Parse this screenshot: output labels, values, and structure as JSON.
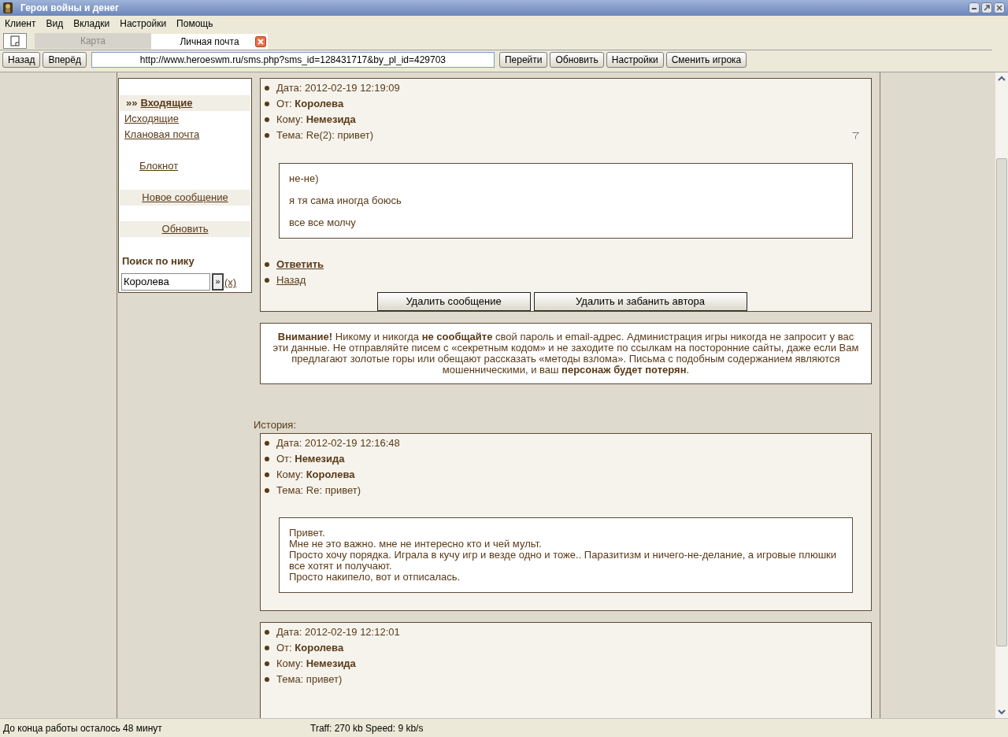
{
  "window": {
    "title": "Герои войны и денег"
  },
  "menu": [
    "Клиент",
    "Вид",
    "Вкладки",
    "Настройки",
    "Помощь"
  ],
  "tabs": [
    {
      "label": "Карта",
      "selected": false,
      "closable": false
    },
    {
      "label": "Личная почта",
      "selected": true,
      "closable": true
    }
  ],
  "nav": {
    "back": "Назад",
    "forward": "Вперёд",
    "url": "http://www.heroeswm.ru/sms.php?sms_id=128431717&by_pl_id=429703",
    "buttons": [
      "Перейти",
      "Обновить",
      "Настройки",
      "Сменить игрока"
    ]
  },
  "sidebar": {
    "items": [
      {
        "kind": "folder",
        "label": "Входящие",
        "marker": "»»",
        "selected": true
      },
      {
        "kind": "folder",
        "label": "Исходящие",
        "selected": false
      },
      {
        "kind": "folder",
        "label": "Клановая почта",
        "selected": false
      },
      {
        "kind": "tool",
        "label": "Блокнот",
        "selected": false
      },
      {
        "kind": "action",
        "label": "Новое сообщение",
        "selected": false
      },
      {
        "kind": "action",
        "label": "Обновить",
        "selected": false
      }
    ],
    "search_label": "Поиск по нику",
    "search_value": "Королева",
    "search_button": "»",
    "clear_link": "(x)"
  },
  "message": {
    "fields": [
      {
        "label": "Дата:",
        "value": "2012-02-19 12:19:09",
        "bold": false
      },
      {
        "label": "От:",
        "value": "Королева",
        "bold": true
      },
      {
        "label": "Кому:",
        "value": "Немезида",
        "bold": true
      },
      {
        "label": "Тема:",
        "value": "Re(2): привет)",
        "bold": false
      }
    ],
    "kind": "paragraphs",
    "body": [
      "не-не)",
      "я тя сама иногда боюсь",
      "все все молчу"
    ],
    "actions": [
      {
        "label": "Ответить",
        "bold": true
      },
      {
        "label": "Назад",
        "bold": false
      }
    ],
    "buttons": [
      "Удалить сообщение",
      "Удалить и забанить автора"
    ]
  },
  "warning": "**Внимание!** Никому и никогда **не сообщайте** свой пароль и email-адрес. Администрация игры никогда не запросит у вас эти данные. Не отправляйте писем с «секретным кодом» и не заходите по ссылкам на посторонние сайты, даже если Вам предлагают золотые горы или обещают рассказать «методы взлома». Письма с подобным содержанием являются мошенническими, и ваш **персонаж будет потерян**.",
  "history_label": "История:",
  "history": [
    {
      "fields": [
        {
          "label": "Дата:",
          "value": "2012-02-19 12:16:48",
          "bold": false
        },
        {
          "label": "От:",
          "value": "Немезида",
          "bold": true
        },
        {
          "label": "Кому:",
          "value": "Королева",
          "bold": true
        },
        {
          "label": "Тема:",
          "value": "Re: привет)",
          "bold": false
        }
      ],
      "kind": "lines",
      "body": [
        "Привет.",
        "Мне не это важно. мне не интересно кто и чей мульт.",
        "Просто хочу порядка. Играла в кучу игр и везде одно и тоже.. Паразитизм и ничего-не-делание, а игровые плюшки все хотят и получают.",
        "Просто накипело, вот и отписалась."
      ]
    },
    {
      "fields": [
        {
          "label": "Дата:",
          "value": "2012-02-19 12:12:01",
          "bold": false
        },
        {
          "label": "От:",
          "value": "Королева",
          "bold": true
        },
        {
          "label": "Кому:",
          "value": "Немезида",
          "bold": true
        },
        {
          "label": "Тема:",
          "value": "привет)",
          "bold": false
        }
      ]
    }
  ],
  "status_bar": {
    "left": "До конца работы осталось 48 минут",
    "right": "Traff: 270 kb Speed: 9 kb/s"
  }
}
